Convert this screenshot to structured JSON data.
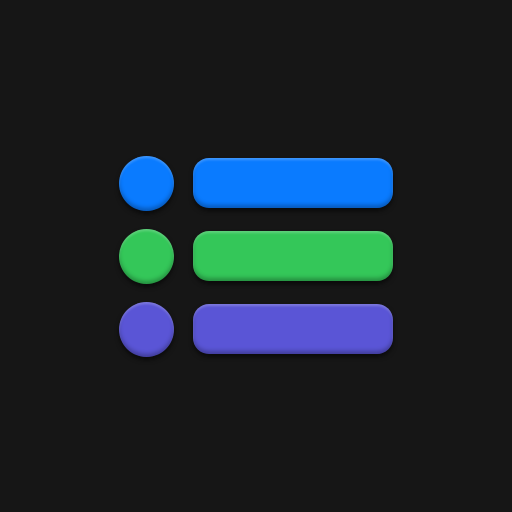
{
  "icon": {
    "name": "list-icon",
    "rows": [
      {
        "color": "#0A7BFF"
      },
      {
        "color": "#34C759"
      },
      {
        "color": "#5A55D6"
      }
    ]
  }
}
